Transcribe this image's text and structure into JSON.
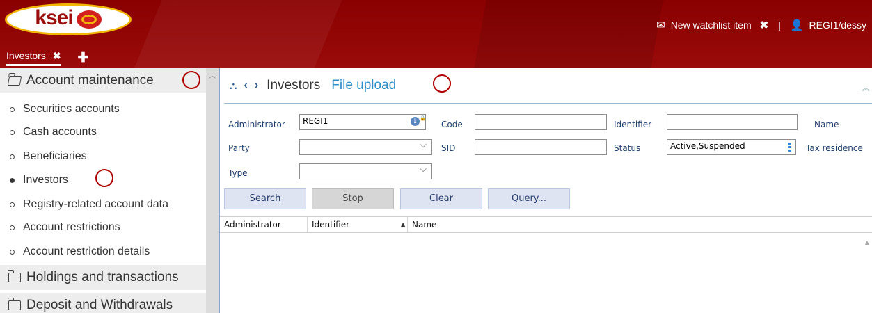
{
  "header": {
    "logo_text": "ksei",
    "watchlist_label": "New watchlist item",
    "separator": "|",
    "user": "REGI1/dessy",
    "icons": {
      "mail": "envelope-icon",
      "close": "close-icon",
      "user": "user-icon"
    },
    "colors": {
      "header_bg": "#8d0000",
      "logo_border": "#f2b705"
    }
  },
  "tabs": [
    {
      "label": "Investors",
      "active": true
    }
  ],
  "sidebar": {
    "groups": [
      {
        "label": "Account maintenance",
        "expanded": true
      },
      {
        "label": "Holdings and transactions",
        "expanded": false
      },
      {
        "label": "Deposit and Withdrawals",
        "expanded": false
      }
    ],
    "items": [
      {
        "label": "Securities accounts",
        "selected": false
      },
      {
        "label": "Cash accounts",
        "selected": false
      },
      {
        "label": "Beneficiaries",
        "selected": false
      },
      {
        "label": "Investors",
        "selected": true
      },
      {
        "label": "Registry-related account data",
        "selected": false
      },
      {
        "label": "Account restrictions",
        "selected": false
      },
      {
        "label": "Account restriction details",
        "selected": false
      }
    ]
  },
  "main": {
    "page_title": "Investors",
    "file_upload_link": "File upload",
    "filters": {
      "administrator": {
        "label": "Administrator",
        "value": "REGI1"
      },
      "code": {
        "label": "Code",
        "value": ""
      },
      "identifier": {
        "label": "Identifier",
        "value": ""
      },
      "name": {
        "label": "Name"
      },
      "party": {
        "label": "Party",
        "value": ""
      },
      "sid": {
        "label": "SID",
        "value": ""
      },
      "status": {
        "label": "Status",
        "value": "Active,Suspended"
      },
      "tax_residence": {
        "label": "Tax residence"
      },
      "type": {
        "label": "Type",
        "value": ""
      }
    },
    "buttons": {
      "search": "Search",
      "stop": "Stop",
      "clear": "Clear",
      "query": "Query..."
    },
    "grid": {
      "columns": [
        "Administrator",
        "Identifier",
        "Name"
      ],
      "sorted_column": "Identifier",
      "sort_direction": "ascending",
      "rows": []
    }
  }
}
